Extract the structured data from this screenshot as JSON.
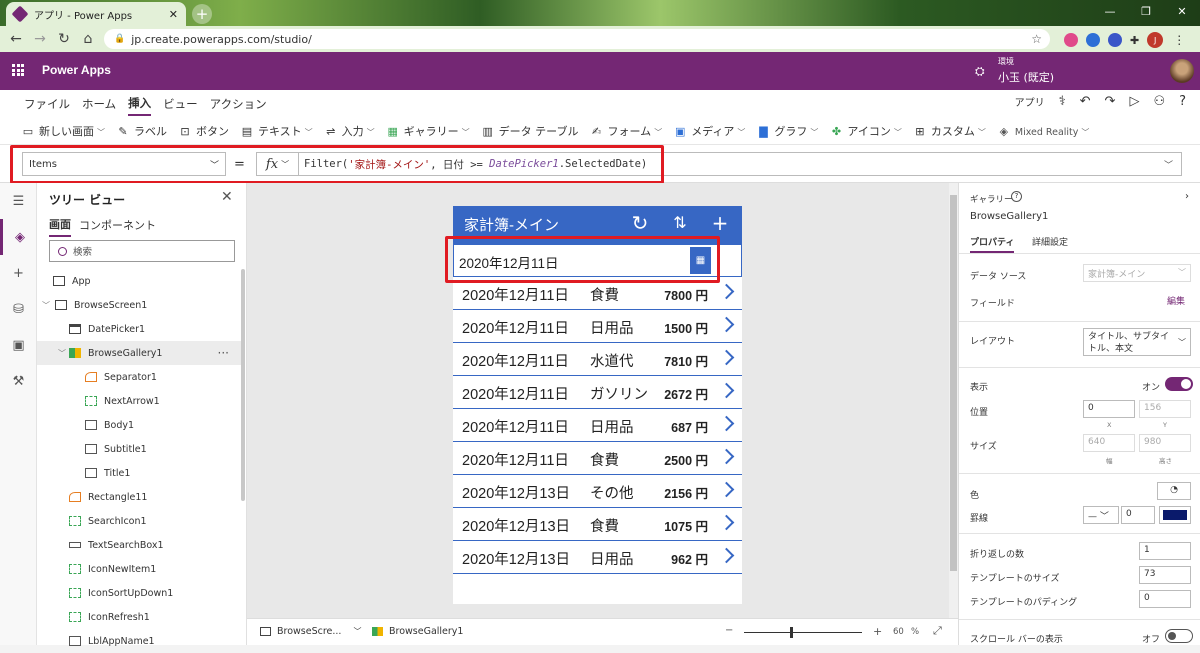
{
  "browser": {
    "tab_title": "アプリ - Power Apps",
    "url": "jp.create.powerapps.com/studio/",
    "profile_initial": "J"
  },
  "header": {
    "app_name": "Power Apps",
    "env_label": "環境",
    "env_name": "小玉 (既定)"
  },
  "menu": {
    "items": [
      "ファイル",
      "ホーム",
      "挿入",
      "ビュー",
      "アクション"
    ],
    "active": "挿入",
    "app_label": "アプリ"
  },
  "ribbon": {
    "items": [
      "新しい画面",
      "ラベル",
      "ボタン",
      "テキスト",
      "入力",
      "ギャラリー",
      "データ テーブル",
      "フォーム",
      "メディア",
      "グラフ",
      "アイコン",
      "カスタム",
      "Mixed Reality"
    ]
  },
  "formula": {
    "property": "Items",
    "fx": "fx",
    "text_func": "Filter(",
    "text_str": "'家計簿-メイン'",
    "text_mid": ", 日付 >= ",
    "text_var": "DatePicker1",
    "text_end": ".SelectedDate)"
  },
  "tree": {
    "title": "ツリー ビュー",
    "tab_screen": "画面",
    "tab_component": "コンポーネント",
    "search_placeholder": "検索",
    "nodes": [
      "App",
      "BrowseScreen1",
      "DatePicker1",
      "BrowseGallery1",
      "Separator1",
      "NextArrow1",
      "Body1",
      "Subtitle1",
      "Title1",
      "Rectangle11",
      "SearchIcon1",
      "TextSearchBox1",
      "IconNewItem1",
      "IconSortUpDown1",
      "IconRefresh1",
      "LblAppName1"
    ]
  },
  "app": {
    "title": "家計簿-メイン",
    "date_value": "2020年12月11日",
    "rows": [
      {
        "date": "2020年12月11日",
        "category": "食費",
        "amount": "7800 円"
      },
      {
        "date": "2020年12月11日",
        "category": "日用品",
        "amount": "1500 円"
      },
      {
        "date": "2020年12月11日",
        "category": "水道代",
        "amount": "7810 円"
      },
      {
        "date": "2020年12月11日",
        "category": "ガソリン",
        "amount": "2672 円"
      },
      {
        "date": "2020年12月11日",
        "category": "日用品",
        "amount": "687 円"
      },
      {
        "date": "2020年12月11日",
        "category": "食費",
        "amount": "2500 円"
      },
      {
        "date": "2020年12月13日",
        "category": "その他",
        "amount": "2156 円"
      },
      {
        "date": "2020年12月13日",
        "category": "食費",
        "amount": "1075 円"
      },
      {
        "date": "2020年12月13日",
        "category": "日用品",
        "amount": "962 円"
      }
    ]
  },
  "status": {
    "screen": "BrowseScre...",
    "gallery": "BrowseGallery1",
    "zoom_minus": "−",
    "zoom_plus": "+",
    "zoom_value": "60",
    "zoom_unit": "%"
  },
  "props": {
    "type_label": "ギャラリー",
    "name": "BrowseGallery1",
    "tab_properties": "プロパティ",
    "tab_advanced": "詳細設定",
    "datasource_label": "データ ソース",
    "datasource_value": "家計簿-メイン",
    "fields_label": "フィールド",
    "fields_edit": "編集",
    "layout_label": "レイアウト",
    "layout_value": "タイトル、サブタイトル、本文",
    "visible_label": "表示",
    "visible_value": "オン",
    "position_label": "位置",
    "x": "0",
    "y": "156",
    "x_label": "X",
    "y_label": "Y",
    "size_label": "サイズ",
    "width": "640",
    "height": "980",
    "width_label": "幅",
    "height_label": "高さ",
    "color_label": "色",
    "border_label": "罫線",
    "border_value": "0",
    "wrap_label": "折り返しの数",
    "wrap_value": "1",
    "template_size_label": "テンプレートのサイズ",
    "template_size_value": "73",
    "template_padding_label": "テンプレートのパディング",
    "template_padding_value": "0",
    "scrollbar_label": "スクロール バーの表示",
    "scrollbar_value": "オフ"
  },
  "colors": {
    "brand": "#742774",
    "app_header": "#3767c4",
    "highlight": "#e01b22"
  }
}
